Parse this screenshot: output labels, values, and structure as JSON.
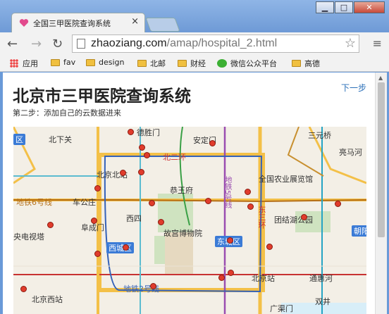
{
  "browser": {
    "tab_title": "全国三甲医院查询系统",
    "tab_close": "×",
    "url_host": "zhaoziang.com",
    "url_path": "/amap/hospital_2.html",
    "window_buttons": {
      "minimize": "▁",
      "maximize": "□",
      "close": "✕"
    },
    "nav": {
      "back": "←",
      "forward": "→",
      "reload": "↻"
    },
    "star": "☆",
    "menu": "≡"
  },
  "bookmarks": [
    {
      "label": "应用",
      "icon": "apps-icon"
    },
    {
      "label": "fav",
      "icon": "folder-icon"
    },
    {
      "label": "design",
      "icon": "folder-icon"
    },
    {
      "label": "北邮",
      "icon": "folder-icon"
    },
    {
      "label": "财经",
      "icon": "folder-icon"
    },
    {
      "label": "微信公众平台",
      "icon": "wechat-icon"
    },
    {
      "label": "高德",
      "icon": "folder-icon"
    }
  ],
  "page": {
    "title": "北京市三甲医院查询系统",
    "subtitle": "第二步：添加自己的云数据进来",
    "next_link": "下一步"
  },
  "map": {
    "labels": {
      "l1": "北下关",
      "l2": "德胜门",
      "l3": "安定门",
      "l4": "三元桥",
      "l5": "北二环",
      "l6": "北京北站",
      "l7": "全国农业展览馆",
      "l8": "亮马河",
      "l9": "地铁6号线",
      "l10": "车公庄",
      "l11": "恭王府",
      "l12": "地铁5号线",
      "l13": "西四",
      "l14": "阜成门",
      "l15": "团结湖公园",
      "l16": "东三环",
      "l17": "央电视塔",
      "l18": "故宫博物院",
      "l19": "北京西站",
      "l20": "地铁2号线",
      "l21": "北京站",
      "l22": "通惠河",
      "l23": "广渠门",
      "l24": "双井"
    },
    "badges": {
      "b1": "区",
      "b2": "西城区",
      "b3": "东城区",
      "b4": "朝阳"
    }
  }
}
